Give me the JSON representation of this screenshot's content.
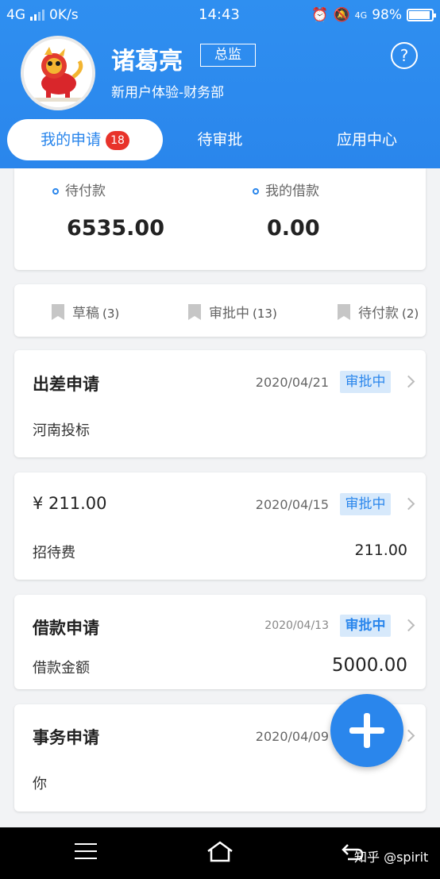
{
  "status_bar": {
    "network": "4G",
    "speed": "0K/s",
    "time": "14:43",
    "network_right": "4G",
    "battery": "98%"
  },
  "user": {
    "name": "诸葛亮",
    "role": "总监",
    "department": "新用户体验-财务部"
  },
  "tabs": [
    {
      "label": "我的申请",
      "badge": "18"
    },
    {
      "label": "待审批"
    },
    {
      "label": "应用中心"
    }
  ],
  "summary": {
    "pending_payment_label": "待付款",
    "pending_payment_value": "6535.00",
    "my_loans_label": "我的借款",
    "my_loans_value": "0.00"
  },
  "filters": [
    {
      "label": "草稿",
      "count": "(3)"
    },
    {
      "label": "审批中",
      "count": "(13)"
    },
    {
      "label": "待付款",
      "count": "(2)"
    }
  ],
  "requests": [
    {
      "title": "出差申请",
      "date": "2020/04/21",
      "status": "审批中",
      "desc": "河南投标",
      "amount": ""
    },
    {
      "title": "¥ 211.00",
      "date": "2020/04/15",
      "status": "审批中",
      "desc": "招待费",
      "amount": "211.00"
    },
    {
      "title": "借款申请",
      "date": "2020/04/13",
      "status": "审批中",
      "desc": "借款金额",
      "amount": "5000.00"
    },
    {
      "title": "事务申请",
      "date": "2020/04/09",
      "status": "",
      "desc": "你",
      "amount": ""
    }
  ],
  "watermark": "知乎 @spirit",
  "colors": {
    "primary": "#2a86ec",
    "badge": "#e8332a",
    "status_bg": "#d7e9fb"
  }
}
